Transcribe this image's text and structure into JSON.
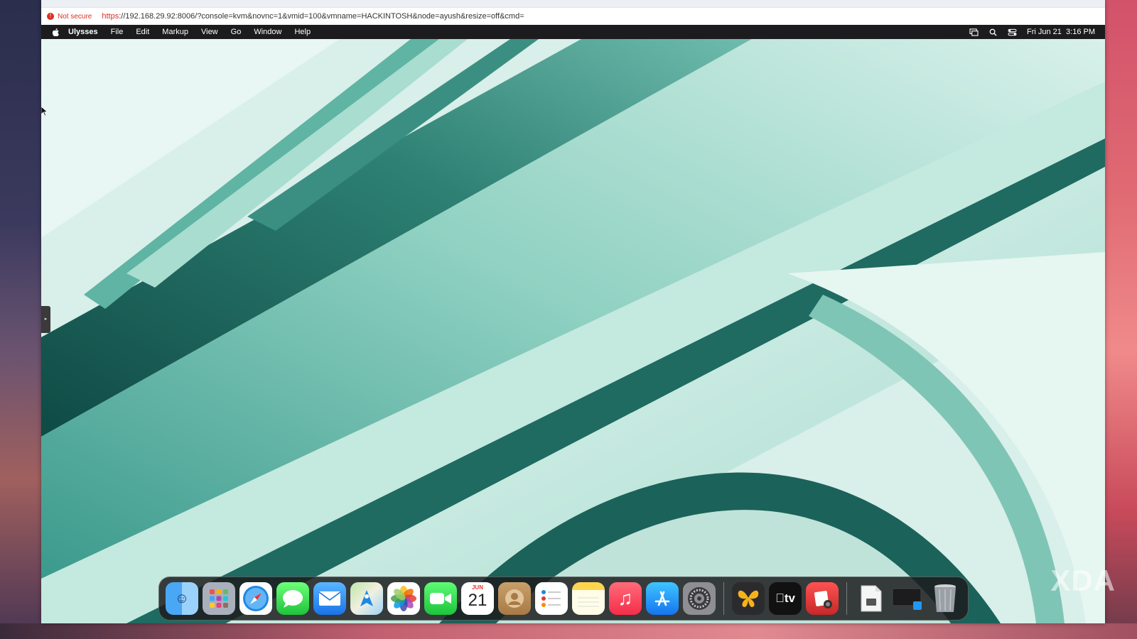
{
  "browser": {
    "security_label": "Not secure",
    "url_scheme": "https",
    "url_rest": "://192.168.29.92:8006/?console=kvm&novnc=1&vmid=100&vmname=HACKINTOSH&node=ayush&resize=off&cmd="
  },
  "menubar": {
    "app_name": "Ulysses",
    "items": [
      "File",
      "Edit",
      "Markup",
      "View",
      "Go",
      "Window",
      "Help"
    ],
    "clock": "Fri Jun 21  3:16 PM"
  },
  "dock": {
    "apps": [
      {
        "name": "Finder",
        "icon": "finder-icon"
      },
      {
        "name": "Launchpad",
        "icon": "launchpad-icon"
      },
      {
        "name": "Safari",
        "icon": "safari-icon"
      },
      {
        "name": "Messages",
        "icon": "messages-icon"
      },
      {
        "name": "Mail",
        "icon": "mail-icon"
      },
      {
        "name": "Maps",
        "icon": "maps-icon"
      },
      {
        "name": "Photos",
        "icon": "photos-icon"
      },
      {
        "name": "FaceTime",
        "icon": "facetime-icon"
      },
      {
        "name": "Calendar",
        "icon": "calendar-icon"
      },
      {
        "name": "Contacts",
        "icon": "contacts-icon"
      },
      {
        "name": "Reminders",
        "icon": "reminders-icon"
      },
      {
        "name": "Notes",
        "icon": "notes-icon"
      },
      {
        "name": "Music",
        "icon": "music-icon"
      },
      {
        "name": "App Store",
        "icon": "app-store-icon"
      },
      {
        "name": "System Settings",
        "icon": "settings-icon"
      },
      {
        "name": "Ulysses",
        "icon": "ulysses-icon"
      },
      {
        "name": "Apple TV",
        "icon": "apple-tv-icon"
      },
      {
        "name": "Photo Booth",
        "icon": "photo-booth-icon"
      },
      {
        "name": "Document",
        "icon": "document-icon"
      },
      {
        "name": "Screen",
        "icon": "screen-icon"
      },
      {
        "name": "Trash",
        "icon": "trash-icon"
      }
    ],
    "calendar": {
      "month": "JUN",
      "day": "21"
    },
    "tv_label": "tv"
  },
  "watermark": "XDA",
  "colors": {
    "wallpaper_dark": "#0f4a45",
    "wallpaper_mid": "#3f9e90",
    "wallpaper_light": "#e6f6f1",
    "not_secure": "#d93025"
  }
}
